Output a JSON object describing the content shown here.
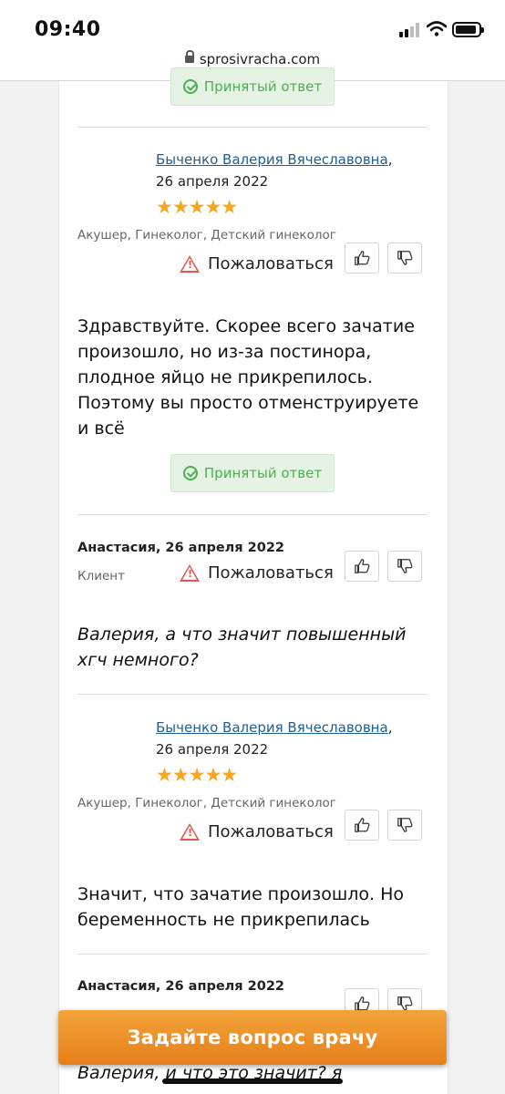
{
  "status": {
    "time": "09:40"
  },
  "browser": {
    "url": "sprosivracha.com"
  },
  "accepted_label": "Принятый ответ",
  "complain_label": "Пожаловаться",
  "messages": [
    {
      "doctor": "Быченко Валерия Вячеславовна",
      "date": "26 апреля 2022",
      "rating_stars": "★★★★★",
      "rating": 4.5,
      "specialty": "Акушер, Гинеколог, Детский гинеколог",
      "text": "Здравствуйте. Скорее всего зачатие произошло, но из-за постинора, плодное яйцо не прикрепилось. Поэтому вы просто отменструируете и всё"
    },
    {
      "author": "Анастасия, 26 апреля 2022",
      "role": "Клиент",
      "text": "Валерия, а что значит повышенный хгч немного?"
    },
    {
      "doctor": "Быченко Валерия Вячеславовна",
      "date": "26 апреля 2022",
      "rating_stars": "★★★★★",
      "rating": 4.5,
      "specialty": "Акушер, Гинеколог, Детский гинеколог",
      "text": "Значит, что зачатие произошло. Но беременность не прикрепилась"
    },
    {
      "author": "Анастасия, 26 апреля 2022",
      "text": "Валерия, и что это значит? я"
    }
  ],
  "cta_label": "Задайте вопрос врачу",
  "colors": {
    "link": "#1e5f96",
    "accent": "#e67f19",
    "accepted": "#4caf50",
    "warning": "#e05a4f",
    "star": "#f5a623"
  }
}
